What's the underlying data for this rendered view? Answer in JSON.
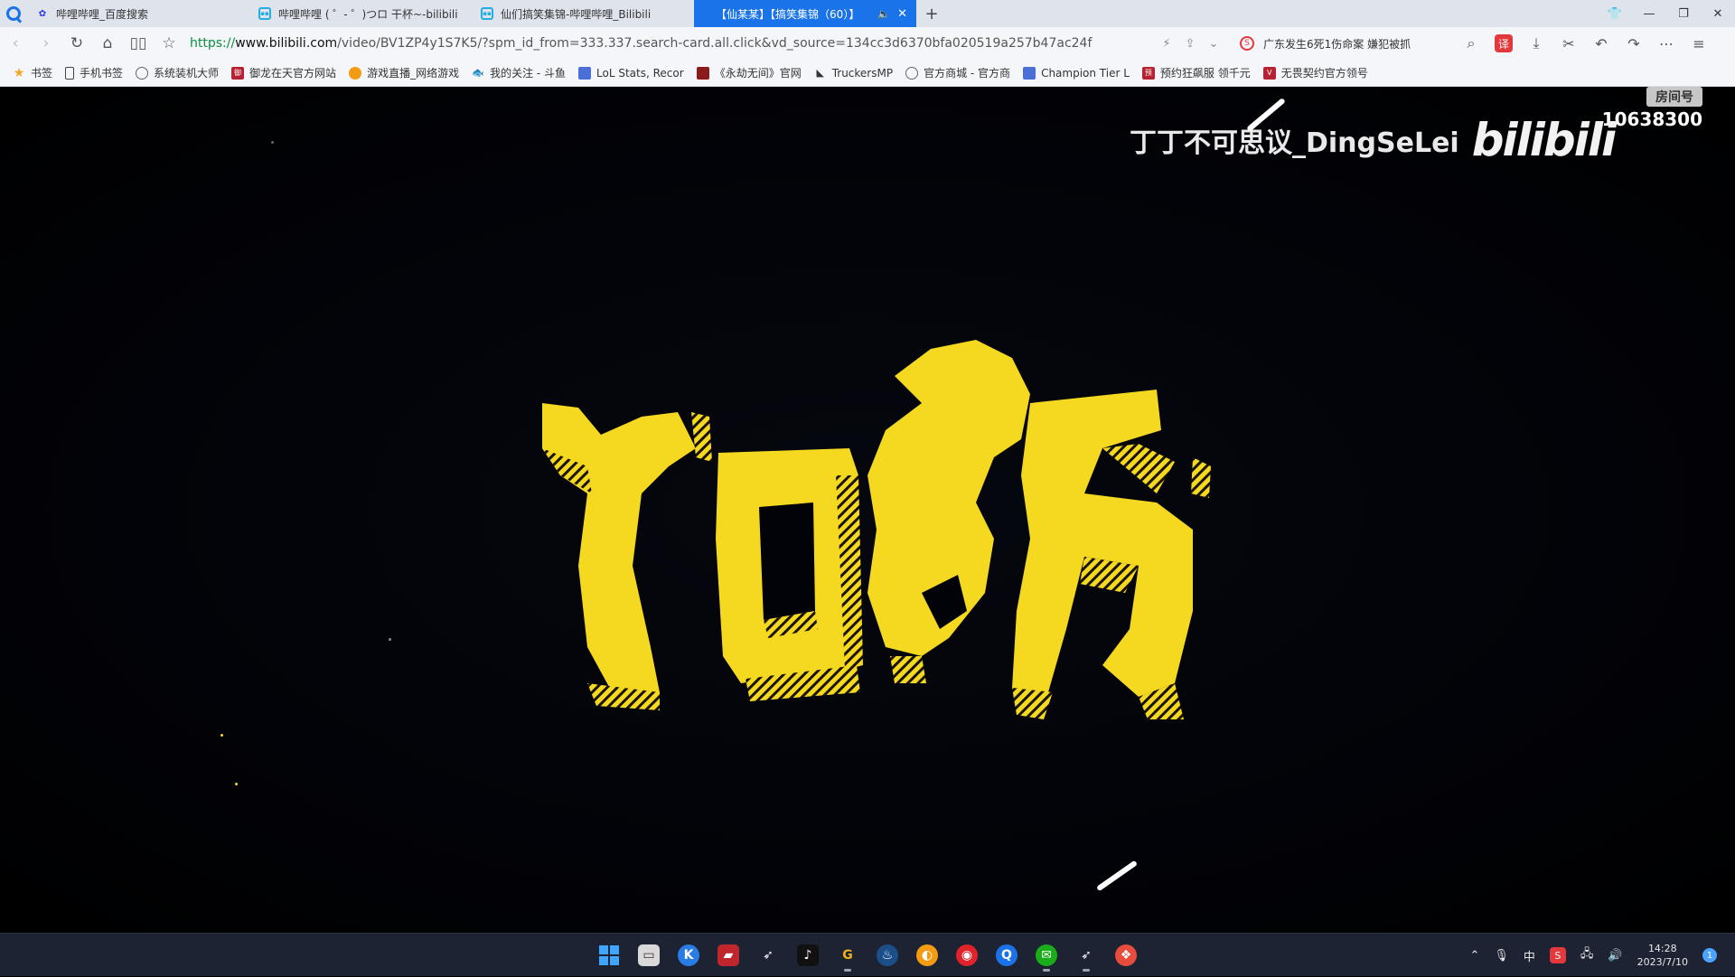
{
  "tabs": [
    {
      "label": "哔哩哔哩_百度搜索",
      "favicon": "baidu-paw-icon",
      "active": false
    },
    {
      "label": "哔哩哔哩 ( ゜- ゜)つロ 干杯~-bilibili",
      "favicon": "bilibili-tv-icon",
      "active": false
    },
    {
      "label": "仙们搞笑集锦-哔哩哔哩_Bilibili",
      "favicon": "bilibili-tv-icon",
      "active": false
    },
    {
      "label": "【仙某某】【搞笑集锦（60）】",
      "favicon": "none",
      "active": true
    }
  ],
  "address": {
    "scheme": "https://",
    "host": "www.bilibili.com",
    "rest": "/video/BV1ZP4y1S7K5/?spm_id_from=333.337.search-card.all.click&vd_source=134cc3d6370bfa020519a257b47ac24f"
  },
  "news_ticker": "广东发生6死1伤命案 嫌犯被抓",
  "translate_label": "译",
  "bookmarks": [
    {
      "label": "书签",
      "icon": "star-icon"
    },
    {
      "label": "手机书签",
      "icon": "phone-icon"
    },
    {
      "label": "系统装机大师",
      "icon": "globe-icon"
    },
    {
      "label": "御龙在天官方网站",
      "icon": "game-red-icon"
    },
    {
      "label": "游戏直播_网络游戏",
      "icon": "orange-circle-icon"
    },
    {
      "label": "我的关注 - 斗鱼",
      "icon": "douyu-icon"
    },
    {
      "label": "LoL Stats, Recor",
      "icon": "blue-square-icon"
    },
    {
      "label": "《永劫无间》官网",
      "icon": "maroon-square-icon"
    },
    {
      "label": "TruckersMP",
      "icon": "truck-icon"
    },
    {
      "label": "官方商城 - 官方商",
      "icon": "globe-icon"
    },
    {
      "label": "Champion Tier L",
      "icon": "blue-square-icon"
    },
    {
      "label": "预约狂飙服 领千元",
      "icon": "game-red-icon"
    },
    {
      "label": "无畏契约官方领号",
      "icon": "red-square-icon"
    }
  ],
  "video": {
    "room_label": "房间号",
    "room_number": "10638300",
    "uploader": "丁丁不可思议_DingSeLei",
    "platform_logo": "bilibili",
    "colors": {
      "title_yellow": "#f5d820",
      "background": "#02030a"
    }
  },
  "taskbar": {
    "apps": [
      "windows-start-icon",
      "file-explorer-icon",
      "kugou-music-icon",
      "game-launcher-icon",
      "feather-app-icon",
      "tiktok-icon",
      "g-app-icon",
      "steam-icon",
      "orange-app-icon",
      "netease-music-icon",
      "browser-icon",
      "wechat-icon",
      "feather-app-icon",
      "red-bird-icon"
    ],
    "ime": "中",
    "time": "14:28",
    "date": "2023/7/10",
    "notifications": "1"
  }
}
